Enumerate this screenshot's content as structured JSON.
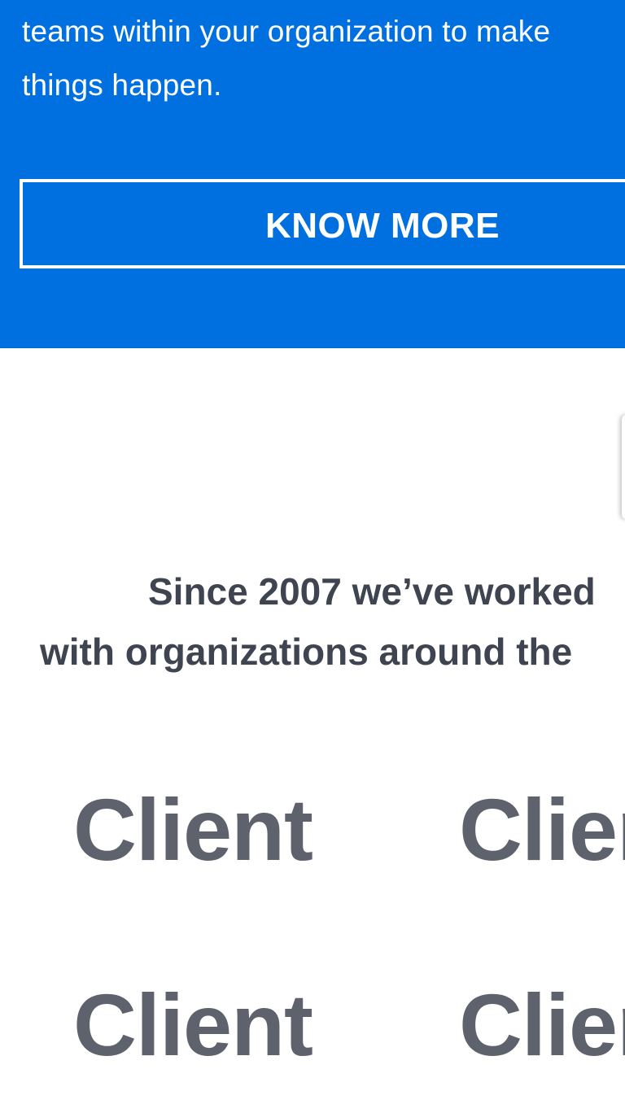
{
  "hero": {
    "line1": "teams within your organization to make",
    "line2": "things happen.",
    "button_label": "KNOW MORE",
    "background_color": "#006fe0"
  },
  "intro": {
    "line1": "Since 2007 we’ve worked",
    "line2": "with organizations around the"
  },
  "clients": [
    {
      "label": "Client"
    },
    {
      "label": "Client"
    },
    {
      "label": "Client"
    },
    {
      "label": "Client"
    }
  ]
}
